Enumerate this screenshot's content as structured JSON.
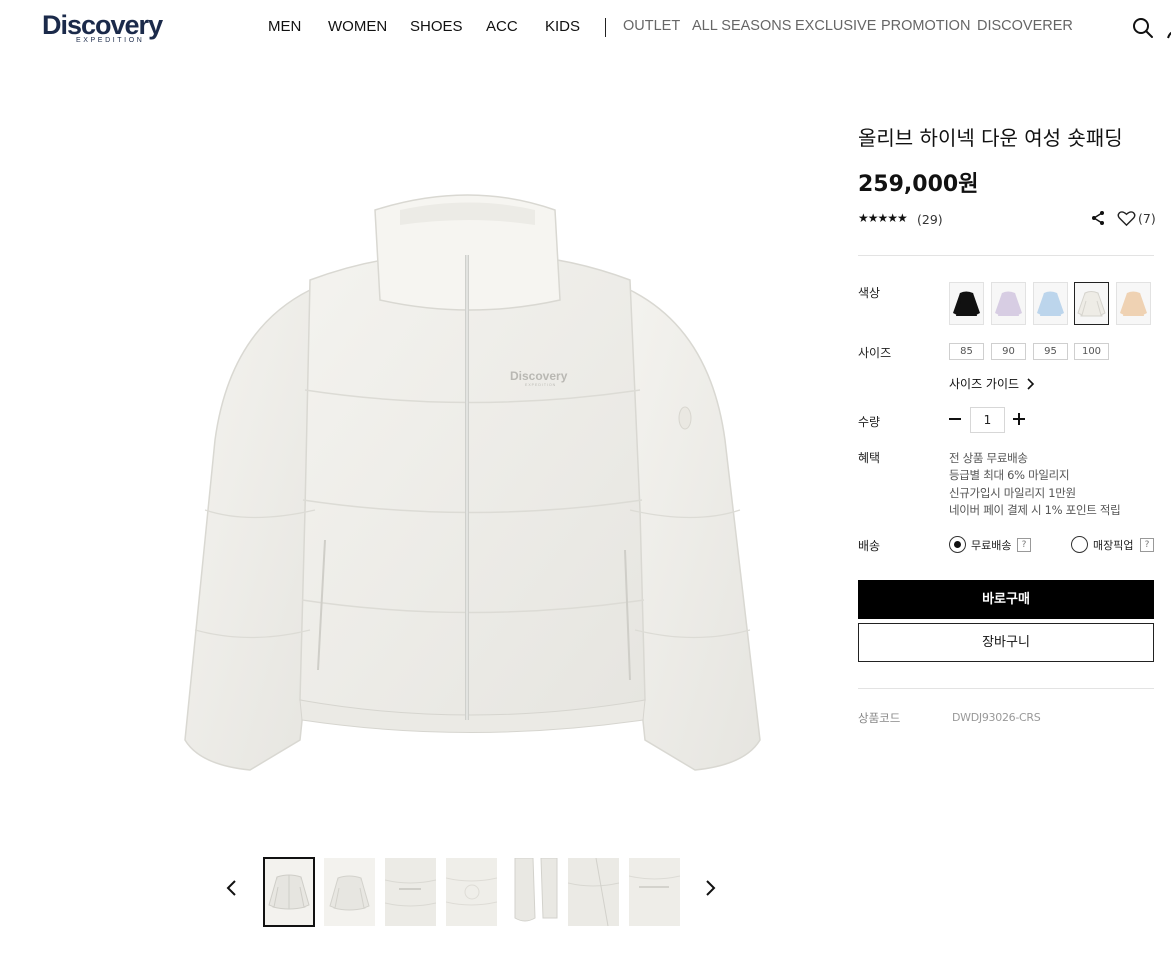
{
  "header": {
    "logo_text": "Discovery",
    "logo_subtext": "EXPEDITION",
    "nav_main": [
      "MEN",
      "WOMEN",
      "SHOES",
      "ACC",
      "KIDS"
    ],
    "nav_sub": [
      "OUTLET",
      "ALL SEASONS",
      "EXCLUSIVE",
      "PROMOTION",
      "DISCOVERER"
    ],
    "icons": [
      "search-icon",
      "user-icon"
    ]
  },
  "product": {
    "title": "올리브 하이넥 다운 여성 숏패딩",
    "price": "259,000원",
    "rating_count": "(29)",
    "rating_stars": 5,
    "like_count": "(7)",
    "image_logo_text": "Discovery",
    "image_logo_subtext": "EXPEDITION",
    "colors_label": "색상",
    "colors": [
      {
        "name": "black",
        "hex": "#111111"
      },
      {
        "name": "lavender",
        "hex": "#d7cde3"
      },
      {
        "name": "light-blue",
        "hex": "#bcd5ec"
      },
      {
        "name": "cream",
        "hex": "#eeece6",
        "selected": true
      },
      {
        "name": "peach",
        "hex": "#efd2b3"
      }
    ],
    "size_label": "사이즈",
    "sizes": [
      "85",
      "90",
      "95",
      "100"
    ],
    "size_guide": "사이즈 가이드",
    "quantity_label": "수량",
    "quantity": "1",
    "benefits_label": "혜택",
    "benefits": [
      "전 상품 무료배송",
      "등급별 최대 6% 마일리지",
      "신규가입시 마일리지 1만원",
      "네이버 페이 결제 시 1% 포인트 적립"
    ],
    "delivery_label": "배송",
    "delivery_options": [
      "무료배송",
      "매장픽업"
    ],
    "help_mark": "?",
    "buy_now": "바로구매",
    "add_to_cart": "장바구니",
    "code_label": "상품코드",
    "code_value": "DWDJ93026-CRS"
  },
  "thumbnails_count": 7
}
